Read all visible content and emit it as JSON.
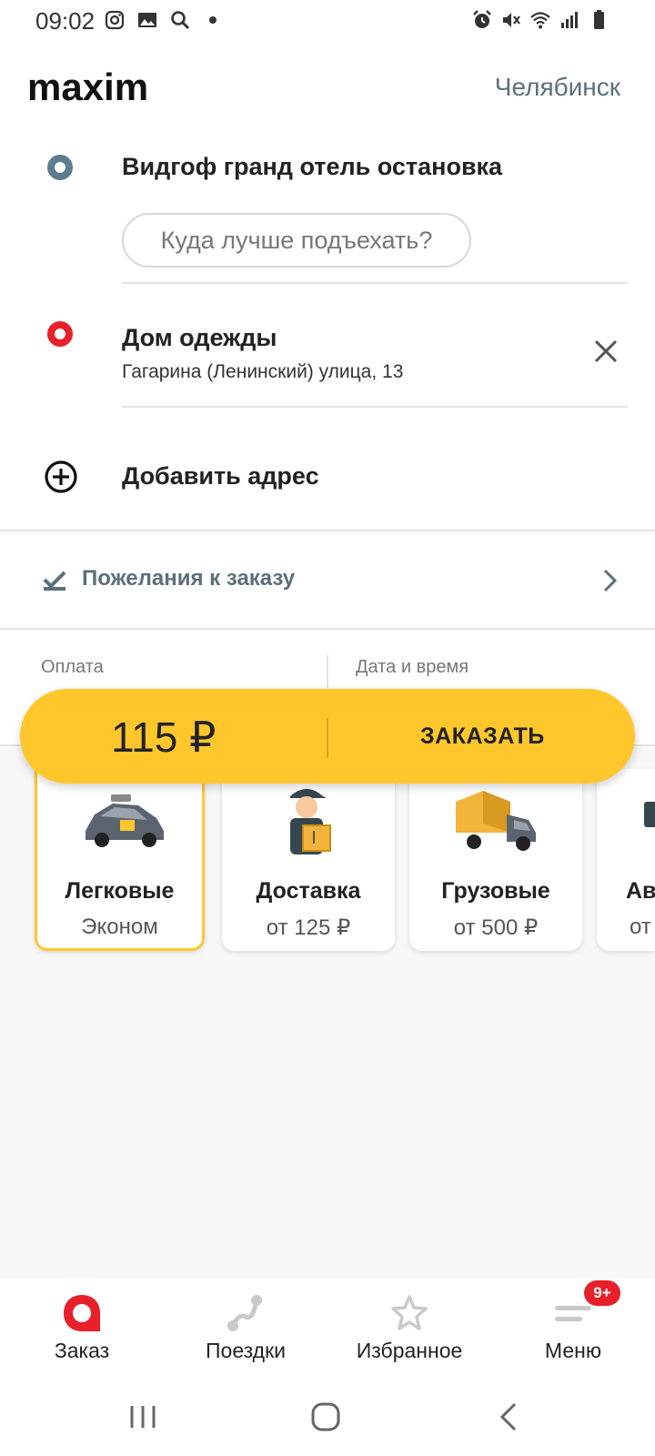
{
  "status_bar": {
    "time": "09:02",
    "left_icons": [
      "instagram-icon",
      "gallery-icon",
      "search-icon",
      "dot-icon"
    ],
    "right_icons": [
      "alarm-icon",
      "mute-icon",
      "wifi-icon",
      "signal-icon",
      "battery-icon"
    ]
  },
  "header": {
    "logo_text": "maxim",
    "city": "Челябинск"
  },
  "route": {
    "from": {
      "title": "Видгоф гранд отель остановка",
      "hint_placeholder": "Куда лучше подъехать?"
    },
    "to": {
      "title": "Дом одежды",
      "subtitle": "Гагарина (Ленинский) улица, 13"
    },
    "add_address_label": "Добавить адрес"
  },
  "wishes": {
    "label": "Пожелания к заказу"
  },
  "options": {
    "payment_label": "Оплата",
    "datetime_label": "Дата и время"
  },
  "order": {
    "price": "115 ₽",
    "button_label": "ЗАКАЗАТЬ"
  },
  "tariffs": [
    {
      "title": "Легковые",
      "subtitle": "Эконом",
      "selected": true
    },
    {
      "title": "Доставка",
      "subtitle": "от 125 ₽",
      "selected": false
    },
    {
      "title": "Грузовые",
      "subtitle": "от 500 ₽",
      "selected": false
    },
    {
      "title": "Ав",
      "subtitle": "от",
      "selected": false
    }
  ],
  "bottom_nav": {
    "items": [
      {
        "label": "Заказ",
        "icon": "order-icon",
        "active": true
      },
      {
        "label": "Поездки",
        "icon": "trips-icon"
      },
      {
        "label": "Избранное",
        "icon": "star-icon"
      },
      {
        "label": "Меню",
        "icon": "menu-icon",
        "badge": "9+"
      }
    ]
  },
  "colors": {
    "accent": "#ffc72c",
    "brand_red": "#e8202a",
    "slate": "#5a707c"
  }
}
